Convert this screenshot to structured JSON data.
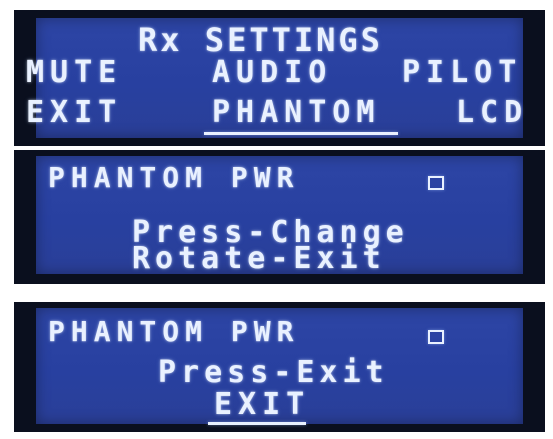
{
  "rx_settings_menu": {
    "title": "Rx SETTINGS",
    "items_row1": [
      "MUTE",
      "AUDIO",
      "PILOT"
    ],
    "items_row2": [
      "EXIT",
      "PHANTOM",
      "LCD"
    ],
    "selected": "PHANTOM"
  },
  "phantom_screen_1": {
    "label": "PHANTOM PWR",
    "checkbox_checked": false,
    "hint_line1": "Press-Change",
    "hint_line2": "Rotate-Exit"
  },
  "phantom_screen_2": {
    "label": "PHANTOM PWR",
    "checkbox_checked": false,
    "hint": "Press-Exit",
    "selected_option": "EXIT"
  },
  "colors": {
    "lcd_background": "#2d45a5",
    "lcd_text": "#e9f1ff",
    "bezel": "#0a0f1e"
  }
}
